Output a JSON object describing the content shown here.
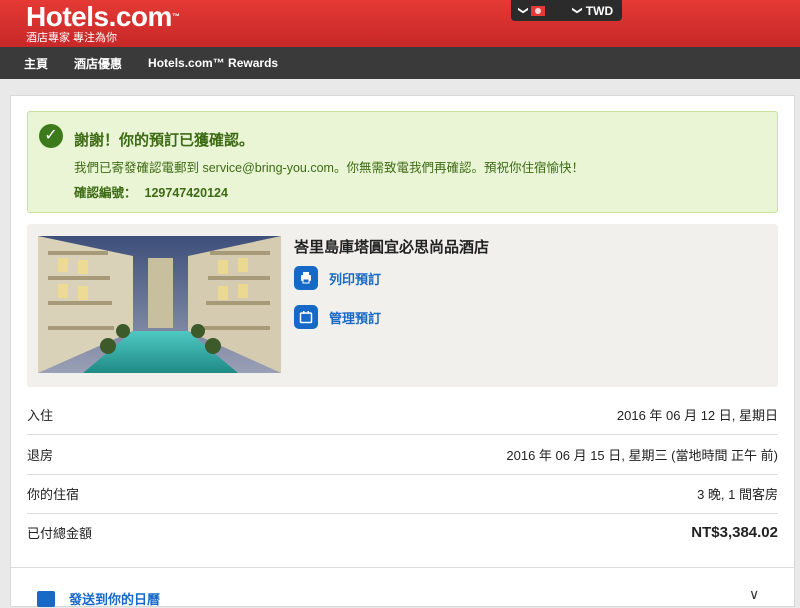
{
  "header": {
    "logo_main": "Hotels.com",
    "logo_tm": "™",
    "logo_sub": "酒店專家 專注為你",
    "currency": "TWD",
    "chev": "❯",
    "colors": {
      "brand_red": "#d32f2f",
      "dark": "#2b2b2b"
    }
  },
  "nav": {
    "items": [
      "主頁",
      "酒店優惠",
      "Hotels.com™ Rewards"
    ]
  },
  "confirmation": {
    "check": "✓",
    "title": "謝謝！你的預訂已獲確認。",
    "message": "我們已寄發確認電郵到 service@bring-you.com。你無需致電我們再確認。預祝你住宿愉快！",
    "id_label": "確認編號：",
    "id_value": "129747420124"
  },
  "hotel": {
    "name": "峇里島庫塔圓宜必思尚品酒店",
    "actions": [
      {
        "label": "列印預訂",
        "icon": "printer-icon"
      },
      {
        "label": "管理預訂",
        "icon": "calendar-icon"
      }
    ]
  },
  "details": [
    {
      "label": "入住",
      "value": "2016 年 06 月 12 日, 星期日"
    },
    {
      "label": "退房",
      "value": "2016 年 06 月 15 日, 星期三 (當地時間 正午 前)"
    },
    {
      "label": "你的住宿",
      "value": "3 晚, 1 間客房"
    },
    {
      "label": "已付總金額",
      "value": "NT$3,384.02"
    }
  ],
  "footer": {
    "text": "發送到你的日曆",
    "chev": "∨"
  }
}
